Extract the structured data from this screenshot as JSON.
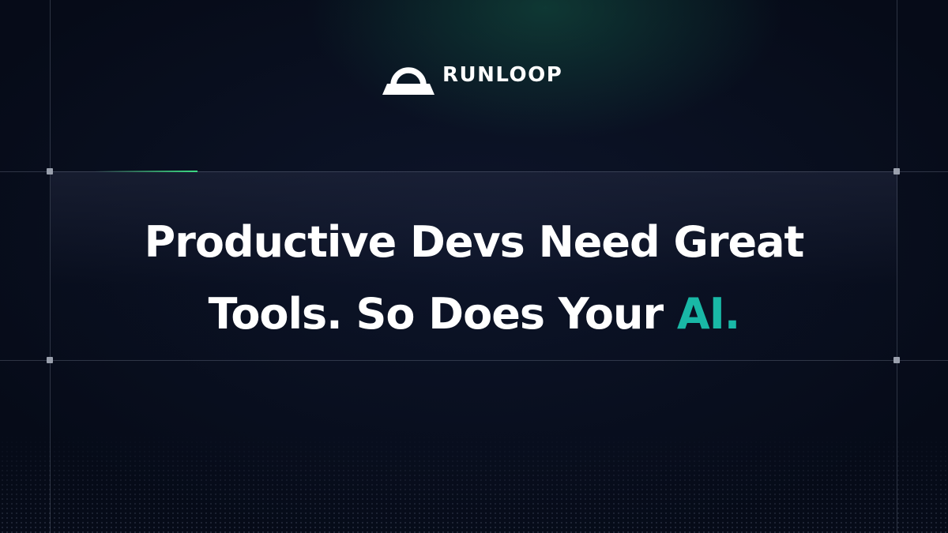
{
  "brand": {
    "name": "RUNLOOP",
    "logo_icon": "runloop-loop-icon"
  },
  "headline": {
    "line1": "Productive Devs Need Great",
    "line2_prefix": "Tools. So Does Your",
    "line2_accent": "AI."
  },
  "colors": {
    "background": "#060b18",
    "accent_teal": "#19b8a6",
    "accent_green": "#3ddc84",
    "text": "#ffffff"
  }
}
